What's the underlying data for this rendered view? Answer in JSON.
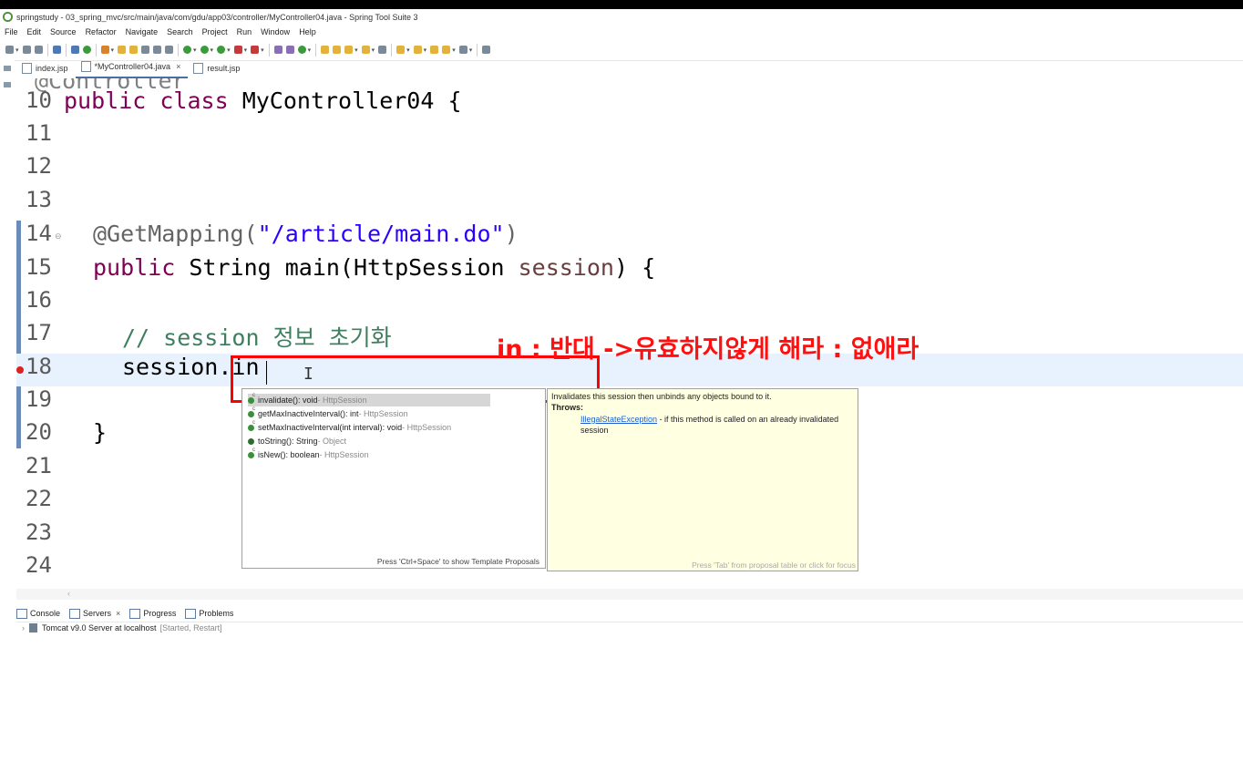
{
  "window": {
    "title": "springstudy - 03_spring_mvc/src/main/java/com/gdu/app03/controller/MyController04.java - Spring Tool Suite 3"
  },
  "menu": [
    "File",
    "Edit",
    "Source",
    "Refactor",
    "Navigate",
    "Search",
    "Project",
    "Run",
    "Window",
    "Help"
  ],
  "tabs": [
    {
      "label": "index.jsp"
    },
    {
      "label": "*MyController04.java",
      "close": "×"
    },
    {
      "label": "result.jsp"
    }
  ],
  "editor": {
    "lines": [
      {
        "n": "10"
      },
      {
        "n": "11"
      },
      {
        "n": "12"
      },
      {
        "n": "13"
      },
      {
        "n": "14"
      },
      {
        "n": "15"
      },
      {
        "n": "16"
      },
      {
        "n": "17"
      },
      {
        "n": "18"
      },
      {
        "n": "19"
      },
      {
        "n": "20"
      },
      {
        "n": "21"
      },
      {
        "n": "22"
      },
      {
        "n": "23"
      },
      {
        "n": "24"
      }
    ],
    "code": {
      "l10_kw1": "public",
      "l10_kw2": "class",
      "l10_rest": " MyController04 {",
      "l14_ann": "@GetMapping(",
      "l14_str": "\"/article/main.do\"",
      "l14_end": ")",
      "l15_kw": "public",
      "l15_mid": " String main(HttpSession ",
      "l15_param": "session",
      "l15_end": ") {",
      "l17_comment": "// session 정보 초기화",
      "l18_code": "session.in",
      "l20_code": "}"
    },
    "partial_top": "@Controller"
  },
  "annotation": {
    "text": "in : 반대 ->유효하지않게 해라 : 없애라"
  },
  "proposals": {
    "items": [
      {
        "name": "invalidate()",
        "sig": " : void",
        "owner": " - HttpSession"
      },
      {
        "name": "getMaxInactiveInterval()",
        "sig": " : int",
        "owner": " - HttpSession"
      },
      {
        "name": "setMaxInactiveInterval(int interval)",
        "sig": " : void",
        "owner": " - HttpSession"
      },
      {
        "name": "toString()",
        "sig": " : String",
        "owner": " - Object"
      },
      {
        "name": "isNew()",
        "sig": " : boolean",
        "owner": " - HttpSession"
      }
    ],
    "footer": "Press 'Ctrl+Space' to show Template Proposals"
  },
  "doc": {
    "description": "Invalidates this session then unbinds any objects bound to it.",
    "throws_label": "Throws:",
    "exception_name": "IllegalStateException",
    "exception_text": " - if this method is called on an already invalidated session",
    "footer": "Press 'Tab' from proposal table or click for focus"
  },
  "bottom_panel": {
    "tabs": [
      {
        "label": "Console"
      },
      {
        "label": "Servers",
        "close": "×"
      },
      {
        "label": "Progress"
      },
      {
        "label": "Problems"
      }
    ],
    "server": {
      "name": "Tomcat v9.0 Server at localhost",
      "status": "[Started, Restart]"
    }
  },
  "colors": {
    "keyword": "#7f0055",
    "string": "#2a00ff",
    "comment": "#3f7f5f",
    "annotation_red": "#ff0000"
  }
}
